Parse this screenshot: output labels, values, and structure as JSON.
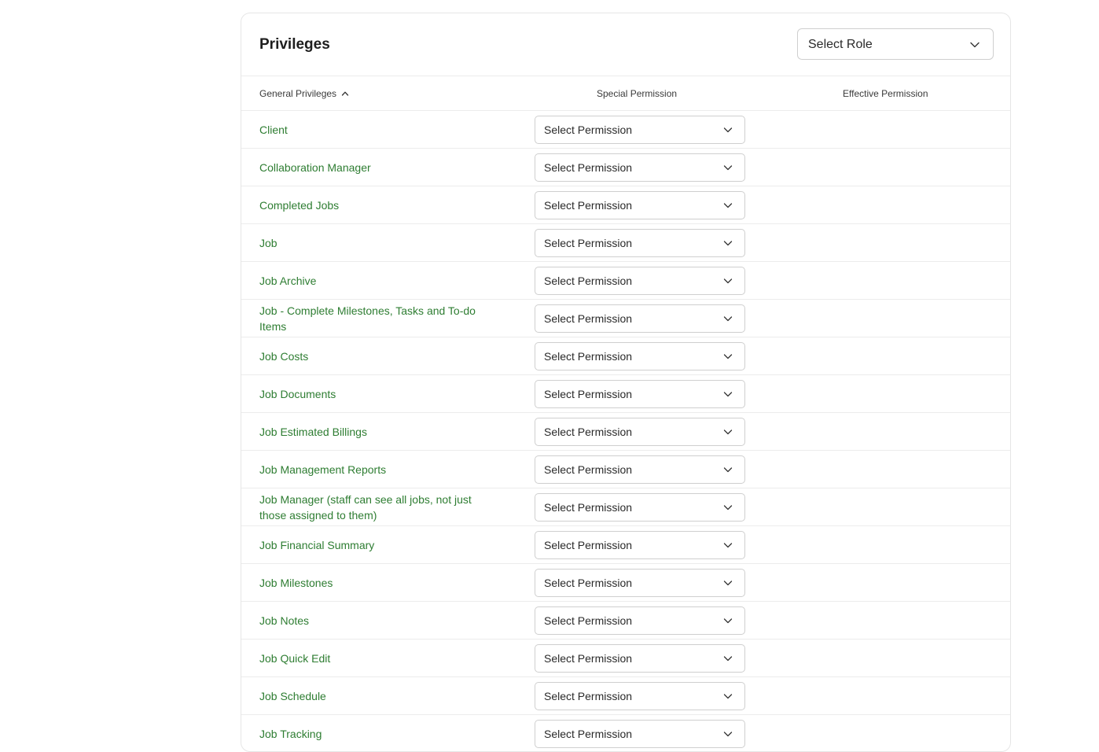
{
  "privileges": {
    "title": "Privileges",
    "role_select": {
      "value": "Select Role",
      "icon": "chevron-down-icon"
    },
    "columns": {
      "general": "General Privileges",
      "general_sort_icon": "chevron-up-icon",
      "special": "Special Permission",
      "effective": "Effective Permission"
    },
    "rows": [
      {
        "name": "Client",
        "permission": "Select Permission",
        "effective": ""
      },
      {
        "name": "Collaboration Manager",
        "permission": "Select Permission",
        "effective": ""
      },
      {
        "name": "Completed Jobs",
        "permission": "Select Permission",
        "effective": ""
      },
      {
        "name": "Job",
        "permission": "Select Permission",
        "effective": ""
      },
      {
        "name": "Job Archive",
        "permission": "Select Permission",
        "effective": ""
      },
      {
        "name": "Job - Complete Milestones, Tasks and To-do Items",
        "permission": "Select Permission",
        "effective": ""
      },
      {
        "name": "Job Costs",
        "permission": "Select Permission",
        "effective": ""
      },
      {
        "name": "Job Documents",
        "permission": "Select Permission",
        "effective": ""
      },
      {
        "name": "Job Estimated Billings",
        "permission": "Select Permission",
        "effective": ""
      },
      {
        "name": "Job Management Reports",
        "permission": "Select Permission",
        "effective": ""
      },
      {
        "name": "Job Manager (staff can see all jobs, not just those assigned to them)",
        "permission": "Select Permission",
        "effective": ""
      },
      {
        "name": "Job Financial Summary",
        "permission": "Select Permission",
        "effective": ""
      },
      {
        "name": "Job Milestones",
        "permission": "Select Permission",
        "effective": ""
      },
      {
        "name": "Job Notes",
        "permission": "Select Permission",
        "effective": ""
      },
      {
        "name": "Job Quick Edit",
        "permission": "Select Permission",
        "effective": ""
      },
      {
        "name": "Job Schedule",
        "permission": "Select Permission",
        "effective": ""
      },
      {
        "name": "Job Tracking",
        "permission": "Select Permission",
        "effective": ""
      }
    ]
  },
  "colors": {
    "link_green": "#2e7d32",
    "border": "#ececec",
    "select_border": "#cfcfcf"
  }
}
